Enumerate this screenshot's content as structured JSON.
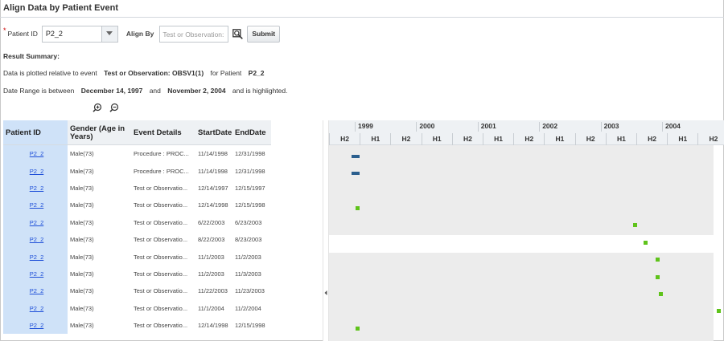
{
  "page": {
    "title": "Align Data by Patient Event"
  },
  "form": {
    "required_marker": "*",
    "patient_id_label": "Patient ID",
    "patient_id_value": "P2_2",
    "align_by_label": "Align By",
    "align_by_placeholder": "Test or Observation:",
    "submit_label": "Submit"
  },
  "summary": {
    "heading": "Result Summary:",
    "line1_prefix": "Data is plotted relative to event",
    "line1_event": "Test or Observation: OBSV1(1)",
    "line1_mid": "for Patient",
    "line1_patient": "P2_2",
    "line2_prefix": "Date Range is between",
    "line2_start": "December 14, 1997",
    "line2_and": "and",
    "line2_end": "November 2, 2004",
    "line2_suffix": "and is highlighted."
  },
  "table": {
    "headers": [
      "Patient ID",
      "Gender (Age in Years)",
      "Event Details",
      "StartDate",
      "EndDate"
    ],
    "rows": [
      {
        "pid": "P2_2",
        "gender": "Male(73)",
        "event": "Procedure : PROC...",
        "start": "11/14/1998",
        "end": "12/31/1998"
      },
      {
        "pid": "P2_2",
        "gender": "Male(73)",
        "event": "Procedure : PROC...",
        "start": "11/14/1998",
        "end": "12/31/1998"
      },
      {
        "pid": "P2_2",
        "gender": "Male(73)",
        "event": "Test or Observatio...",
        "start": "12/14/1997",
        "end": "12/15/1997"
      },
      {
        "pid": "P2_2",
        "gender": "Male(73)",
        "event": "Test or Observatio...",
        "start": "12/14/1998",
        "end": "12/15/1998"
      },
      {
        "pid": "P2_2",
        "gender": "Male(73)",
        "event": "Test or Observatio...",
        "start": "6/22/2003",
        "end": "6/23/2003"
      },
      {
        "pid": "P2_2",
        "gender": "Male(73)",
        "event": "Test or Observatio...",
        "start": "8/22/2003",
        "end": "8/23/2003"
      },
      {
        "pid": "P2_2",
        "gender": "Male(73)",
        "event": "Test or Observatio...",
        "start": "11/1/2003",
        "end": "11/2/2003"
      },
      {
        "pid": "P2_2",
        "gender": "Male(73)",
        "event": "Test or Observatio...",
        "start": "11/2/2003",
        "end": "11/3/2003"
      },
      {
        "pid": "P2_2",
        "gender": "Male(73)",
        "event": "Test or Observatio...",
        "start": "11/22/2003",
        "end": "11/23/2003"
      },
      {
        "pid": "P2_2",
        "gender": "Male(73)",
        "event": "Test or Observatio...",
        "start": "11/1/2004",
        "end": "11/2/2004"
      },
      {
        "pid": "P2_2",
        "gender": "Male(73)",
        "event": "Test or Observatio...",
        "start": "12/14/1998",
        "end": "12/15/1998"
      }
    ]
  },
  "gantt": {
    "years": [
      "1999",
      "2000",
      "2001",
      "2002",
      "2003",
      "2004"
    ],
    "halves": [
      "H2",
      "H1",
      "H2",
      "H1",
      "H2",
      "H1",
      "H2",
      "H1",
      "H2",
      "H1",
      "H2",
      "H1",
      "H2"
    ],
    "colors": {
      "bar": "#2b5f8e",
      "point": "#5fc31b",
      "highlight": "#ececec"
    }
  },
  "icons": {
    "dropdown": "chevron-down-icon",
    "search": "search-icon",
    "zoom_in": "zoom-in-icon",
    "zoom_out": "zoom-out-icon",
    "splitter": "collapse-left-icon"
  }
}
